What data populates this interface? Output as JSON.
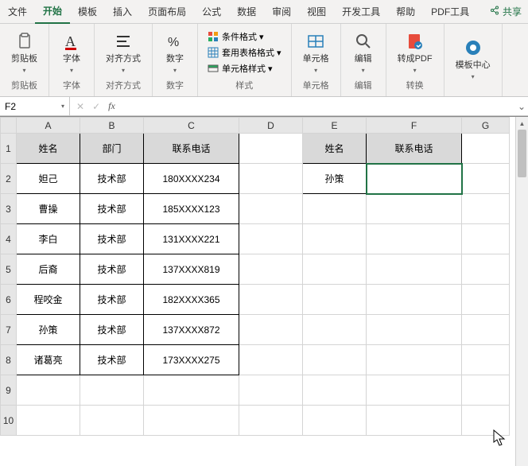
{
  "tabs": {
    "file": "文件",
    "home": "开始",
    "template": "模板",
    "insert": "插入",
    "layout": "页面布局",
    "formula": "公式",
    "data": "数据",
    "review": "审阅",
    "view": "视图",
    "dev": "开发工具",
    "help": "帮助",
    "pdf": "PDF工具",
    "share": "共享"
  },
  "ribbon": {
    "clipboard": {
      "label": "剪贴板",
      "btn": "剪贴板"
    },
    "font": {
      "label": "字体",
      "btn": "字体"
    },
    "align": {
      "label": "对齐方式",
      "btn": "对齐方式"
    },
    "number": {
      "label": "数字",
      "btn": "数字"
    },
    "styles": {
      "label": "样式",
      "cond": "条件格式 ▾",
      "fmtTable": "套用表格格式 ▾",
      "cellStyle": "单元格样式 ▾"
    },
    "cells": {
      "label": "单元格",
      "btn": "单元格"
    },
    "editing": {
      "label": "编辑",
      "btn": "编辑"
    },
    "convert": {
      "label": "转换",
      "btn": "转成PDF"
    },
    "templates": {
      "label": "",
      "btn": "模板中心"
    }
  },
  "nameBox": "F2",
  "fx": "fx",
  "colHeaders": [
    "A",
    "B",
    "C",
    "D",
    "E",
    "F",
    "G"
  ],
  "rowHeaders": [
    "1",
    "2",
    "3",
    "4",
    "5",
    "6",
    "7",
    "8",
    "9",
    "10"
  ],
  "sheet": {
    "headerRow": {
      "name": "姓名",
      "dept": "部门",
      "phone": "联系电话"
    },
    "lookup": {
      "name": "姓名",
      "phone": "联系电话",
      "value": "孙策"
    },
    "rows": [
      {
        "name": "妲己",
        "dept": "技术部",
        "phone": "180XXXX234"
      },
      {
        "name": "曹操",
        "dept": "技术部",
        "phone": "185XXXX123"
      },
      {
        "name": "李白",
        "dept": "技术部",
        "phone": "131XXXX221"
      },
      {
        "name": "后裔",
        "dept": "技术部",
        "phone": "137XXXX819"
      },
      {
        "name": "程咬金",
        "dept": "技术部",
        "phone": "182XXXX365"
      },
      {
        "name": "孙策",
        "dept": "技术部",
        "phone": "137XXXX872"
      },
      {
        "name": "诸葛亮",
        "dept": "技术部",
        "phone": "173XXXX275"
      }
    ]
  }
}
